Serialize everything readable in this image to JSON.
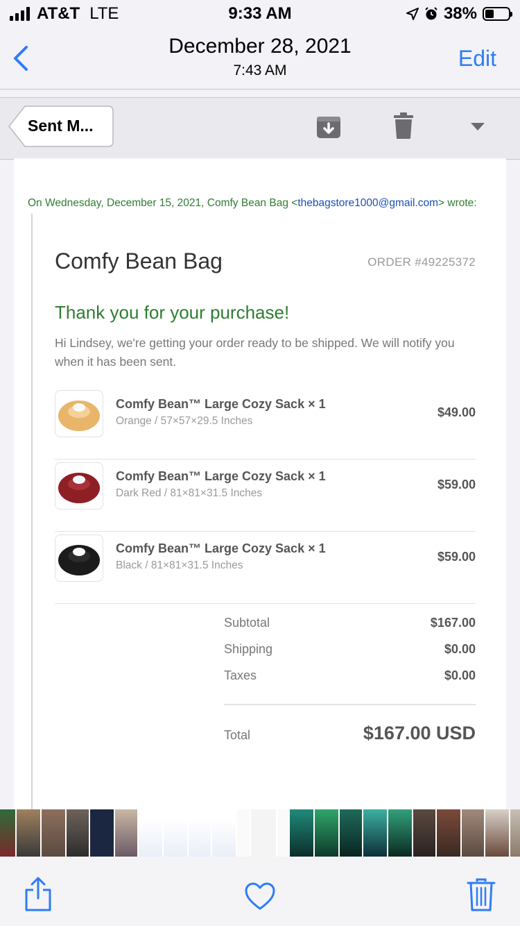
{
  "status_bar": {
    "carrier": "AT&T",
    "network": "LTE",
    "time": "9:33 AM",
    "battery": "38%"
  },
  "nav": {
    "date": "December 28, 2021",
    "time": "7:43 AM",
    "edit_label": "Edit"
  },
  "toolbar": {
    "mailbox_label": "Sent M..."
  },
  "email": {
    "quote_prefix": "On Wednesday, December 15, 2021, Comfy Bean Bag <",
    "quote_email": "thebagstore1000@gmail.com",
    "quote_suffix": "> wrote:",
    "store_name": "Comfy Bean Bag",
    "order_number": "ORDER #49225372",
    "thanks": "Thank you for your purchase!",
    "intro": "Hi Lindsey, we're getting your order ready to be shipped. We will notify you when it has been sent.",
    "items": [
      {
        "name": "Comfy Bean™ Large Cozy Sack × 1",
        "variant": "Orange / 57×57×29.5 Inches",
        "price": "$49.00",
        "color": "#e9b56a"
      },
      {
        "name": "Comfy Bean™ Large Cozy Sack × 1",
        "variant": "Dark Red / 81×81×31.5 Inches",
        "price": "$59.00",
        "color": "#8e1f25"
      },
      {
        "name": "Comfy Bean™ Large Cozy Sack × 1",
        "variant": "Black / 81×81×31.5 Inches",
        "price": "$59.00",
        "color": "#1b1b1b"
      }
    ],
    "summary": {
      "subtotal_label": "Subtotal",
      "subtotal": "$167.00",
      "shipping_label": "Shipping",
      "shipping": "$0.00",
      "taxes_label": "Taxes",
      "taxes": "$0.00",
      "total_label": "Total",
      "total": "$167.00 USD"
    }
  },
  "colors": {
    "accent": "#2e7cf6",
    "green": "#2e7d32",
    "link": "#1a4fb5"
  }
}
